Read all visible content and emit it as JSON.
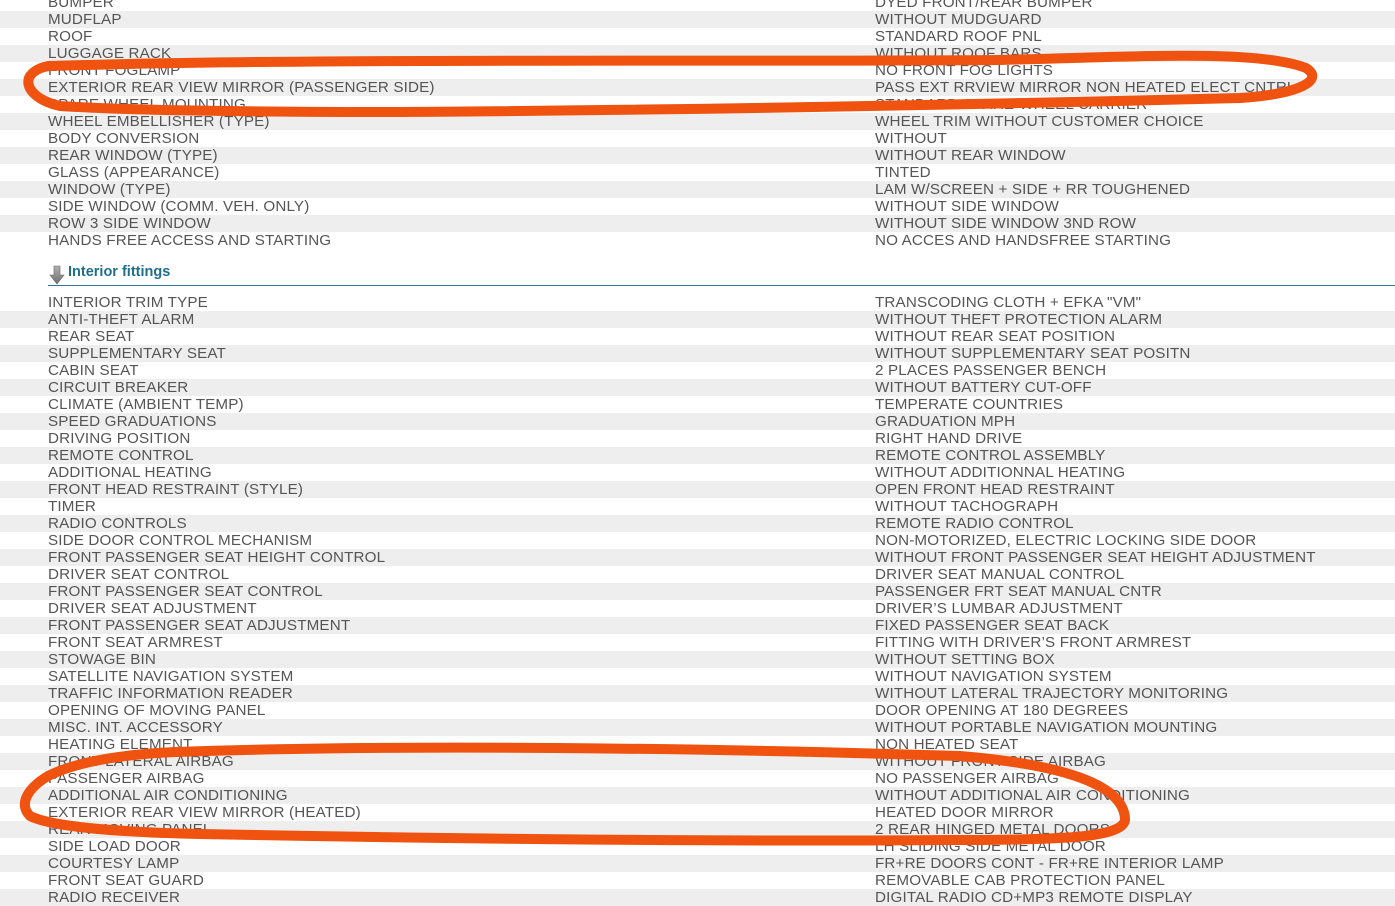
{
  "exterior": {
    "rows": [
      {
        "label": "BUMPER",
        "value": "DYED FRONT/REAR BUMPER"
      },
      {
        "label": "MUDFLAP",
        "value": "WITHOUT MUDGUARD"
      },
      {
        "label": "ROOF",
        "value": "STANDARD ROOF PNL"
      },
      {
        "label": "LUGGAGE RACK",
        "value": "WITHOUT ROOF BARS"
      },
      {
        "label": "FRONT FOGLAMP",
        "value": "NO FRONT FOG LIGHTS"
      },
      {
        "label": "EXTERIOR REAR VIEW MIRROR (PASSENGER SIDE)",
        "value": "PASS EXT RRVIEW MIRROR NON HEATED ELECT CNTRL"
      },
      {
        "label": "SPARE WHEEL MOUNTING",
        "value": "STANDARD SPARE-WHEEL CARRIER"
      },
      {
        "label": "WHEEL EMBELLISHER (TYPE)",
        "value": "WHEEL TRIM WITHOUT CUSTOMER CHOICE"
      },
      {
        "label": "BODY CONVERSION",
        "value": "WITHOUT"
      },
      {
        "label": "REAR WINDOW (TYPE)",
        "value": "WITHOUT REAR WINDOW"
      },
      {
        "label": "GLASS (APPEARANCE)",
        "value": "TINTED"
      },
      {
        "label": "WINDOW (TYPE)",
        "value": "LAM W/SCREEN + SIDE + RR TOUGHENED"
      },
      {
        "label": "SIDE WINDOW (COMM. VEH. ONLY)",
        "value": "WITHOUT SIDE WINDOW"
      },
      {
        "label": "ROW 3 SIDE WINDOW",
        "value": "WITHOUT SIDE WINDOW 3ND ROW"
      },
      {
        "label": "HANDS FREE ACCESS AND STARTING",
        "value": "NO ACCES AND HANDSFREE STARTING"
      }
    ]
  },
  "interior": {
    "title": "Interior fittings",
    "rows": [
      {
        "label": "INTERIOR TRIM TYPE",
        "value": "TRANSCODING CLOTH + EFKA \"VM\""
      },
      {
        "label": "ANTI-THEFT ALARM",
        "value": "WITHOUT THEFT PROTECTION ALARM"
      },
      {
        "label": "REAR SEAT",
        "value": "WITHOUT REAR SEAT POSITION"
      },
      {
        "label": "SUPPLEMENTARY SEAT",
        "value": "WITHOUT SUPPLEMENTARY SEAT POSITN"
      },
      {
        "label": "CABIN SEAT",
        "value": "2 PLACES PASSENGER BENCH"
      },
      {
        "label": "CIRCUIT BREAKER",
        "value": "WITHOUT BATTERY CUT-OFF"
      },
      {
        "label": "CLIMATE (AMBIENT TEMP)",
        "value": "TEMPERATE COUNTRIES"
      },
      {
        "label": "SPEED GRADUATIONS",
        "value": "GRADUATION MPH"
      },
      {
        "label": "DRIVING POSITION",
        "value": "RIGHT HAND DRIVE"
      },
      {
        "label": "REMOTE CONTROL",
        "value": "REMOTE CONTROL ASSEMBLY"
      },
      {
        "label": "ADDITIONAL HEATING",
        "value": "WITHOUT ADDITIONNAL HEATING"
      },
      {
        "label": "FRONT HEAD RESTRAINT (STYLE)",
        "value": "OPEN FRONT HEAD RESTRAINT"
      },
      {
        "label": "TIMER",
        "value": "WITHOUT TACHOGRAPH"
      },
      {
        "label": "RADIO CONTROLS",
        "value": "REMOTE RADIO CONTROL"
      },
      {
        "label": "SIDE DOOR CONTROL MECHANISM",
        "value": "NON-MOTORIZED, ELECTRIC LOCKING SIDE DOOR"
      },
      {
        "label": "FRONT PASSENGER SEAT HEIGHT CONTROL",
        "value": "WITHOUT FRONT PASSENGER SEAT HEIGHT ADJUSTMENT"
      },
      {
        "label": "DRIVER SEAT CONTROL",
        "value": "DRIVER SEAT MANUAL CONTROL"
      },
      {
        "label": "FRONT PASSENGER SEAT CONTROL",
        "value": "PASSENGER FRT SEAT MANUAL CNTR"
      },
      {
        "label": "DRIVER SEAT ADJUSTMENT",
        "value": "DRIVER’S LUMBAR ADJUSTMENT"
      },
      {
        "label": "FRONT PASSENGER SEAT ADJUSTMENT",
        "value": "FIXED PASSENGER SEAT BACK"
      },
      {
        "label": "FRONT SEAT ARMREST",
        "value": "FITTING WITH DRIVER’S FRONT ARMREST"
      },
      {
        "label": "STOWAGE BIN",
        "value": "WITHOUT SETTING BOX"
      },
      {
        "label": "SATELLITE NAVIGATION SYSTEM",
        "value": "WITHOUT NAVIGATION SYSTEM"
      },
      {
        "label": "TRAFFIC INFORMATION READER",
        "value": "WITHOUT LATERAL TRAJECTORY MONITORING"
      },
      {
        "label": "OPENING OF MOVING PANEL",
        "value": "DOOR OPENING AT 180 DEGREES"
      },
      {
        "label": "MISC. INT. ACCESSORY",
        "value": "WITHOUT PORTABLE NAVIGATION MOUNTING"
      },
      {
        "label": "HEATING ELEMENT",
        "value": "NON HEATED SEAT"
      },
      {
        "label": "FRONT LATERAL AIRBAG",
        "value": "WITHOUT FRONT SIDE AIRBAG"
      },
      {
        "label": "PASSENGER AIRBAG",
        "value": "NO PASSENGER AIRBAG"
      },
      {
        "label": "ADDITIONAL AIR CONDITIONING",
        "value": "WITHOUT ADDITIONAL AIR CONDITIONING"
      },
      {
        "label": "EXTERIOR REAR VIEW MIRROR (HEATED)",
        "value": "HEATED DOOR MIRROR"
      },
      {
        "label": "REAR MOVING PANEL",
        "value": "2 REAR HINGED METAL DOORS"
      },
      {
        "label": "SIDE LOAD DOOR",
        "value": "LH SLIDING SIDE METAL DOOR"
      },
      {
        "label": "COURTESY LAMP",
        "value": "FR+RE DOORS CONT - FR+RE INTERIOR LAMP"
      },
      {
        "label": "FRONT SEAT GUARD",
        "value": "REMOVABLE CAB PROTECTION PANEL"
      },
      {
        "label": "RADIO RECEIVER",
        "value": "DIGITAL RADIO CD+MP3 REMOTE DISPLAY"
      }
    ]
  },
  "icons": {
    "section_arrow": "down-arrow-icon"
  },
  "colors": {
    "marker": "#f0520f",
    "section_title": "#1f6e8c",
    "row_alt": "#eeeeee",
    "text": "#555555"
  }
}
